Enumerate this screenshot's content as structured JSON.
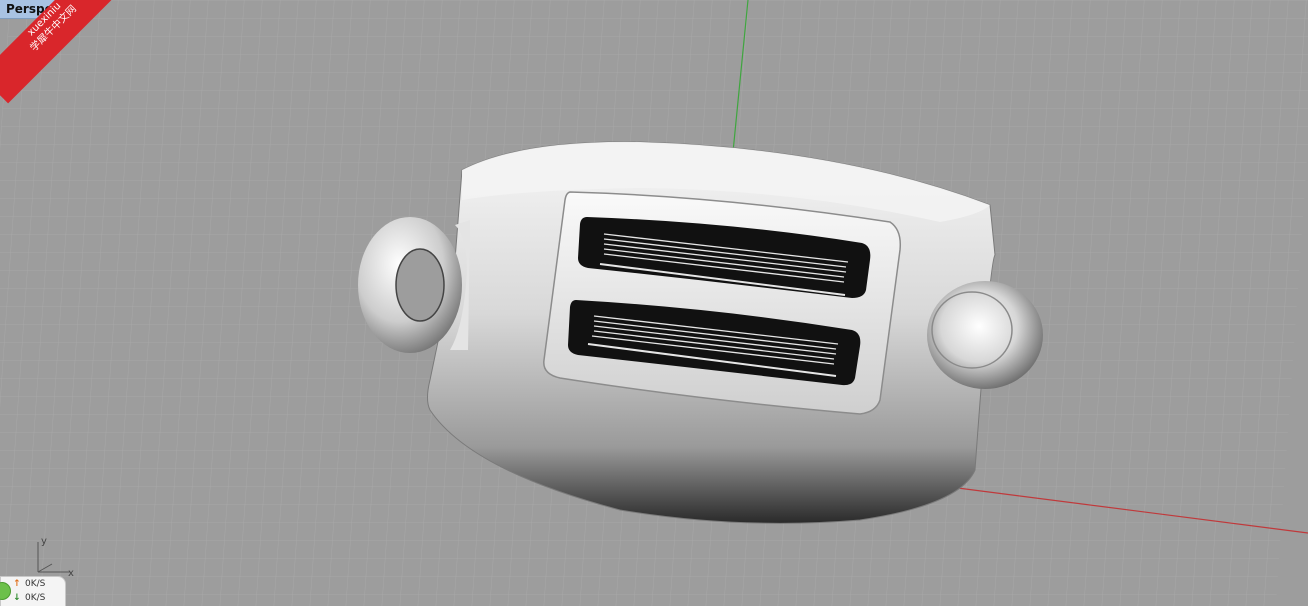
{
  "viewport": {
    "name": "Perspective",
    "tab_label": "Perspective"
  },
  "watermark": {
    "line1": "xuexiniu",
    "line2": "学犀牛中文网"
  },
  "network_monitor": {
    "upload": "0K/S",
    "download": "0K/S"
  },
  "axes": {
    "x_label": "x",
    "y_label": "y",
    "x_axis_color": "#c0393b",
    "y_axis_color": "#3fa63f"
  },
  "colors": {
    "viewport_bg": "#9d9d9d",
    "grid_minor": "#a9a9a9",
    "grid_major": "#8c8c8c",
    "tab_bg": "#a9c3e3"
  },
  "model": {
    "object": "toaster",
    "shading": "shaded"
  }
}
